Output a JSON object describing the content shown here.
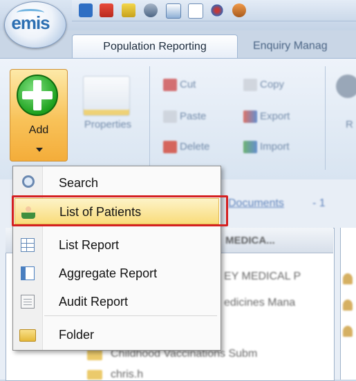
{
  "app": {
    "logo_text": "emis"
  },
  "tabs": {
    "active": "Population Reporting",
    "inactive": "Enquiry Manag"
  },
  "ribbon": {
    "add_label": "Add",
    "properties_label": "Properties",
    "cut_label": "Cut",
    "paste_label": "Paste",
    "delete_label": "Delete",
    "copy_label": "Copy",
    "export_label": "Export",
    "import_label": "Import",
    "right_partial": "R"
  },
  "menu": {
    "items": [
      {
        "label": "Search",
        "icon": "search-icon"
      },
      {
        "label": "List of Patients",
        "icon": "patient-icon",
        "selected": true
      },
      {
        "label": "List Report",
        "icon": "grid-icon"
      },
      {
        "label": "Aggregate Report",
        "icon": "aggregate-icon"
      },
      {
        "label": "Audit Report",
        "icon": "audit-icon"
      },
      {
        "label": "Folder",
        "icon": "folder-icon"
      }
    ]
  },
  "background": {
    "documents_link": "Documents",
    "documents_suffix": "- 1",
    "tree_header": "MEDICA...",
    "tree_rows": [
      "EY MEDICAL P",
      "edicines Mana",
      "Childhood Vaccinations Subm",
      "chris.h"
    ]
  },
  "colors": {
    "highlight": "#d42020",
    "menu_selected": "#f9dc7a",
    "add_button": "#f8c259"
  }
}
